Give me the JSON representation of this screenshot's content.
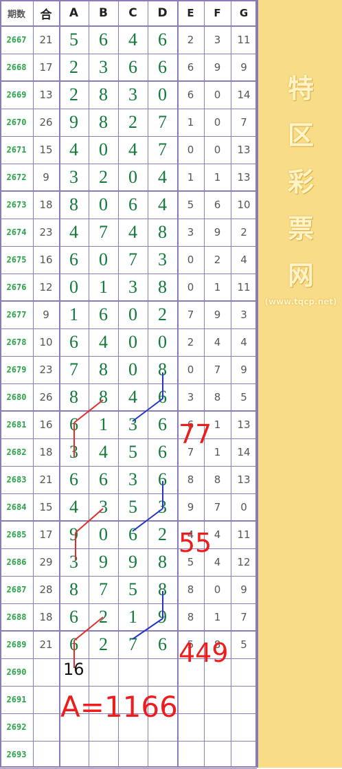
{
  "table": {
    "headers": [
      "期数",
      "合",
      "A",
      "B",
      "C",
      "D",
      "E",
      "F",
      "G"
    ],
    "rows": [
      {
        "period": "2667",
        "sum": "21",
        "a": "5",
        "b": "6",
        "c": "4",
        "d": "6",
        "e": "2",
        "f": "3",
        "g": "11"
      },
      {
        "period": "2668",
        "sum": "17",
        "a": "2",
        "b": "3",
        "c": "6",
        "d": "6",
        "e": "6",
        "f": "9",
        "g": "9"
      },
      {
        "period": "2669",
        "sum": "13",
        "a": "2",
        "b": "8",
        "c": "3",
        "d": "0",
        "e": "6",
        "f": "0",
        "g": "14"
      },
      {
        "period": "2670",
        "sum": "26",
        "a": "9",
        "b": "8",
        "c": "2",
        "d": "7",
        "e": "1",
        "f": "0",
        "g": "7"
      },
      {
        "period": "2671",
        "sum": "15",
        "a": "4",
        "b": "0",
        "c": "4",
        "d": "7",
        "e": "0",
        "f": "0",
        "g": "13"
      },
      {
        "period": "2672",
        "sum": "9",
        "a": "3",
        "b": "2",
        "c": "0",
        "d": "4",
        "e": "1",
        "f": "1",
        "g": "13"
      },
      {
        "period": "2673",
        "sum": "18",
        "a": "8",
        "b": "0",
        "c": "6",
        "d": "4",
        "e": "5",
        "f": "6",
        "g": "10"
      },
      {
        "period": "2674",
        "sum": "23",
        "a": "4",
        "b": "7",
        "c": "4",
        "d": "8",
        "e": "3",
        "f": "9",
        "g": "2"
      },
      {
        "period": "2675",
        "sum": "16",
        "a": "6",
        "b": "0",
        "c": "7",
        "d": "3",
        "e": "0",
        "f": "2",
        "g": "4"
      },
      {
        "period": "2676",
        "sum": "12",
        "a": "0",
        "b": "1",
        "c": "3",
        "d": "8",
        "e": "0",
        "f": "1",
        "g": "11"
      },
      {
        "period": "2677",
        "sum": "9",
        "a": "1",
        "b": "6",
        "c": "0",
        "d": "2",
        "e": "7",
        "f": "9",
        "g": "3"
      },
      {
        "period": "2678",
        "sum": "10",
        "a": "6",
        "b": "4",
        "c": "0",
        "d": "0",
        "e": "2",
        "f": "4",
        "g": "4"
      },
      {
        "period": "2679",
        "sum": "23",
        "a": "7",
        "b": "8",
        "c": "0",
        "d": "8",
        "e": "0",
        "f": "7",
        "g": "9"
      },
      {
        "period": "2680",
        "sum": "26",
        "a": "8",
        "b": "8",
        "c": "4",
        "d": "6",
        "e": "3",
        "f": "8",
        "g": "5"
      },
      {
        "period": "2681",
        "sum": "16",
        "a": "6",
        "b": "1",
        "c": "3",
        "d": "6",
        "e": "6",
        "f": "1",
        "g": "13"
      },
      {
        "period": "2682",
        "sum": "18",
        "a": "3",
        "b": "4",
        "c": "5",
        "d": "6",
        "e": "7",
        "f": "1",
        "g": "14"
      },
      {
        "period": "2683",
        "sum": "21",
        "a": "6",
        "b": "6",
        "c": "3",
        "d": "6",
        "e": "8",
        "f": "8",
        "g": "13"
      },
      {
        "period": "2684",
        "sum": "15",
        "a": "4",
        "b": "3",
        "c": "5",
        "d": "3",
        "e": "9",
        "f": "7",
        "g": "0"
      },
      {
        "period": "2685",
        "sum": "17",
        "a": "9",
        "b": "0",
        "c": "6",
        "d": "2",
        "e": "4",
        "f": "4",
        "g": "11"
      },
      {
        "period": "2686",
        "sum": "29",
        "a": "3",
        "b": "9",
        "c": "9",
        "d": "8",
        "e": "5",
        "f": "4",
        "g": "12"
      },
      {
        "period": "2687",
        "sum": "28",
        "a": "8",
        "b": "7",
        "c": "5",
        "d": "8",
        "e": "8",
        "f": "0",
        "g": "9"
      },
      {
        "period": "2688",
        "sum": "18",
        "a": "6",
        "b": "2",
        "c": "1",
        "d": "9",
        "e": "8",
        "f": "1",
        "g": "7"
      },
      {
        "period": "2689",
        "sum": "21",
        "a": "6",
        "b": "2",
        "c": "7",
        "d": "6",
        "e": "5",
        "f": "8",
        "g": "5"
      },
      {
        "period": "2690",
        "sum": "",
        "a": "",
        "b": "",
        "c": "",
        "d": "",
        "e": "",
        "f": "",
        "g": ""
      },
      {
        "period": "2691",
        "sum": "",
        "a": "",
        "b": "",
        "c": "",
        "d": "",
        "e": "",
        "f": "",
        "g": ""
      },
      {
        "period": "2692",
        "sum": "",
        "a": "",
        "b": "",
        "c": "",
        "d": "",
        "e": "",
        "f": "",
        "g": ""
      },
      {
        "period": "2693",
        "sum": "",
        "a": "",
        "b": "",
        "c": "",
        "d": "",
        "e": "",
        "f": "",
        "g": ""
      }
    ]
  },
  "annotations": {
    "n77": "77",
    "n55": "55",
    "n449": "449",
    "a_total": "A=1166",
    "n16": "16"
  },
  "watermark": {
    "chars": [
      "特",
      "区",
      "彩",
      "票",
      "网"
    ],
    "url": "(www.tqcp.net)"
  },
  "colors": {
    "grid_line": "#8a7ab8",
    "main_digits": "#117a3a",
    "period_text": "#2aa34a",
    "annotation_red": "#ee1c1c",
    "trend_red": "#e52b2b",
    "trend_blue": "#2233cc",
    "sidebar_bg": "#f8dc88"
  }
}
